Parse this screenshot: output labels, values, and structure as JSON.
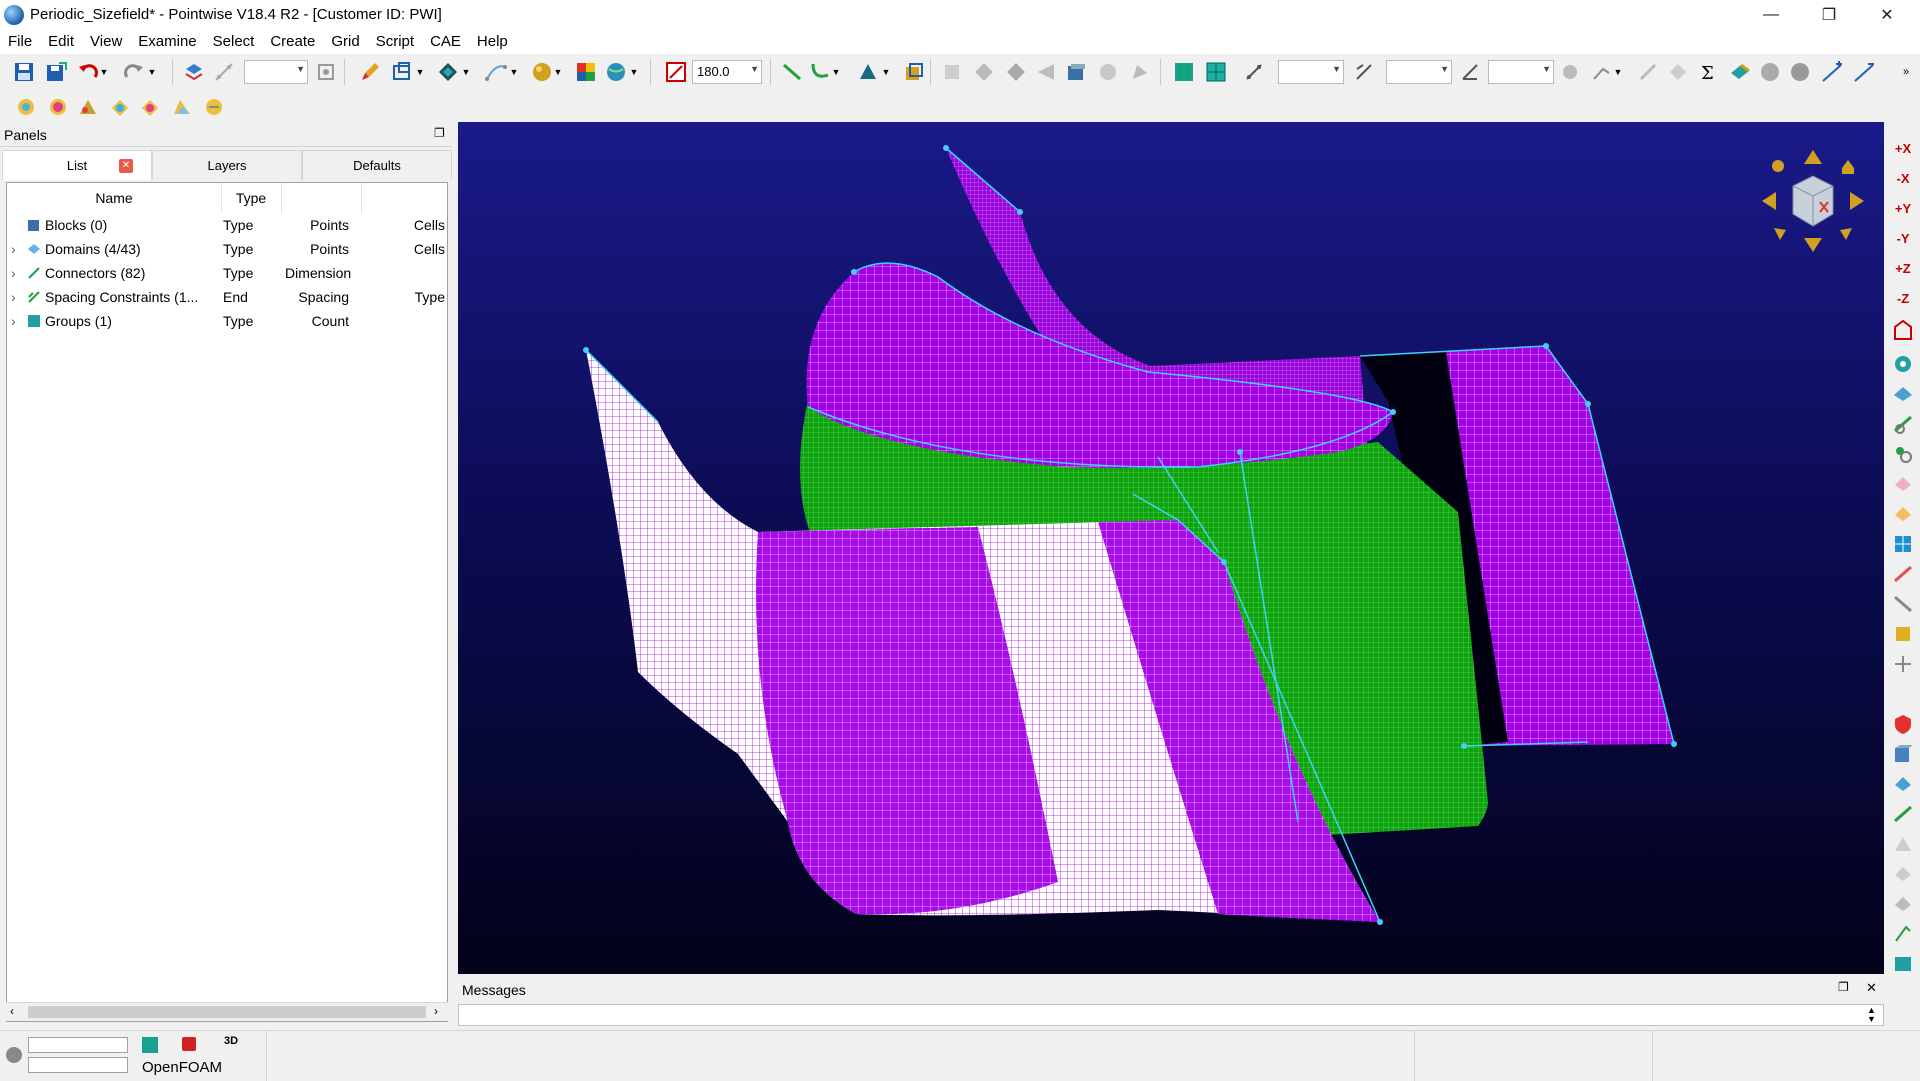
{
  "window": {
    "title": "Periodic_Sizefield* - Pointwise V18.4 R2 - [Customer ID: PWI]",
    "minimize": "—",
    "restore": "❐",
    "close": "✕"
  },
  "menu": [
    "File",
    "Edit",
    "View",
    "Examine",
    "Select",
    "Create",
    "Grid",
    "Script",
    "CAE",
    "Help"
  ],
  "toolbar": {
    "angle_value": "180.0",
    "empty_combo": ""
  },
  "panels": {
    "title": "Panels",
    "tabs": [
      "List",
      "Layers",
      "Defaults"
    ],
    "columns": [
      "Name",
      "Type"
    ],
    "rows": [
      {
        "name": "Blocks (0)",
        "c1": "Type",
        "c2": "Points",
        "c3": "Cells",
        "icon": "block-icon",
        "expand": ""
      },
      {
        "name": "Domains (4/43)",
        "c1": "Type",
        "c2": "Points",
        "c3": "Cells",
        "icon": "domain-icon",
        "expand": "›"
      },
      {
        "name": "Connectors (82)",
        "c1": "Type",
        "c2": "Dimension",
        "c3": "",
        "icon": "connector-icon",
        "expand": "›"
      },
      {
        "name": "Spacing Constraints (1...",
        "c1": "End",
        "c2": "Spacing",
        "c3": "Type",
        "icon": "spacing-icon",
        "expand": "›"
      },
      {
        "name": "Groups (1)",
        "c1": "Type",
        "c2": "Count",
        "c3": "",
        "icon": "group-icon",
        "expand": "›"
      }
    ]
  },
  "messages": {
    "title": "Messages"
  },
  "right_toolbar": [
    "+X",
    "-X",
    "+Y",
    "-Y",
    "+Z",
    "-Z"
  ],
  "status": {
    "solver": "OpenFOAM",
    "mode_3d": "3D"
  },
  "colors": {
    "mesh_purple": "#a000e0",
    "mesh_green": "#00c000",
    "mesh_white": "#ffffff",
    "connector_cyan": "#40d0ff"
  }
}
